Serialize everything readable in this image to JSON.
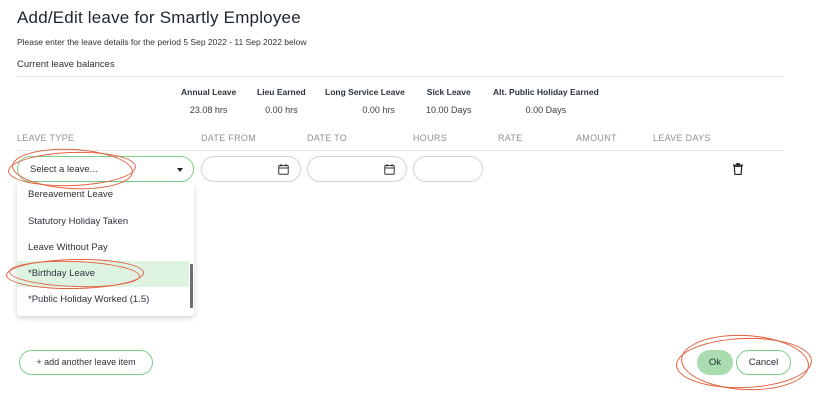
{
  "page": {
    "title": "Add/Edit leave for Smartly Employee",
    "subtitle": "Please enter the leave details for the period 5 Sep 2022 - 11 Sep 2022 below",
    "balances_label": "Current leave balances"
  },
  "balances": [
    {
      "label": "Annual Leave",
      "value": "23.08 hrs"
    },
    {
      "label": "Lieu Earned",
      "value": "0.00 hrs"
    },
    {
      "label": "Long Service Leave",
      "value": "0.00 hrs"
    },
    {
      "label": "Sick Leave",
      "value": "10.00 Days"
    },
    {
      "label": "Alt. Public Holiday Earned",
      "value": "0.00 Days"
    }
  ],
  "table": {
    "headers": [
      "LEAVE TYPE",
      "DATE FROM",
      "DATE TO",
      "HOURS",
      "RATE",
      "AMOUNT",
      "LEAVE DAYS"
    ]
  },
  "row": {
    "leave_select_value": "Select a leave..."
  },
  "dropdown": {
    "options": [
      "Bereavement Leave",
      "Statutory Holiday Taken",
      "Leave Without Pay",
      "*Birthday Leave",
      "*Public Holiday Worked (1.5)"
    ],
    "highlighted": "*Birthday Leave"
  },
  "buttons": {
    "add_item": "+ add another leave item",
    "ok": "Ok",
    "cancel": "Cancel"
  },
  "icons": {
    "calendar": "calendar-icon",
    "trash": "trash-icon",
    "caret": "chevron-down-icon"
  },
  "colors": {
    "accent_green": "#7fcf8a",
    "ok_fill": "#a9ddb0",
    "selected_row": "#dff3e3",
    "annotation": "#e2613f"
  }
}
